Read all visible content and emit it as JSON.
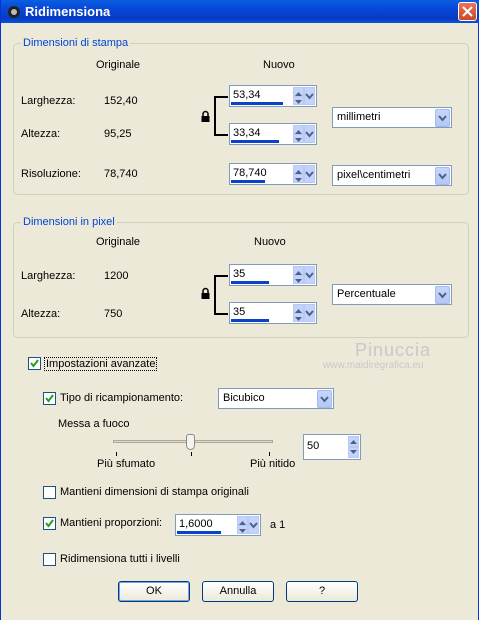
{
  "window": {
    "title": "Ridimensiona"
  },
  "print_size": {
    "title": "Dimensioni di stampa",
    "col_original": "Originale",
    "col_new": "Nuovo",
    "width_label": "Larghezza:",
    "width_original": "152,40",
    "width_new": "53,34",
    "height_label": "Altezza:",
    "height_original": "95,25",
    "height_new": "33,34",
    "units": "millimetri",
    "resolution_label": "Risoluzione:",
    "resolution_original": "78,740",
    "resolution_new": "78,740",
    "resolution_units": "pixel\\centimetri"
  },
  "pixel_size": {
    "title": "Dimensioni in pixel",
    "col_original": "Originale",
    "col_new": "Nuovo",
    "width_label": "Larghezza:",
    "width_original": "1200",
    "width_new": "35",
    "height_label": "Altezza:",
    "height_original": "750",
    "height_new": "35",
    "units": "Percentuale"
  },
  "advanced": {
    "label": "Impostazioni avanzate",
    "checked": true,
    "resample_label": "Tipo di ricampionamento:",
    "resample_checked": true,
    "resample_value": "Bicubico",
    "sharpness_label": "Messa a fuoco",
    "soft_label": "Più sfumato",
    "sharp_label": "Più nitido",
    "sharpness_value": "50",
    "keep_print_label": "Mantieni dimensioni di stampa originali",
    "keep_print_checked": false,
    "keep_ratio_label": "Mantieni proporzioni:",
    "keep_ratio_checked": true,
    "ratio_value": "1,6000",
    "ratio_suffix": "a 1",
    "resize_all_label": "Ridimensiona tutti i livelli",
    "resize_all_checked": false
  },
  "watermark": {
    "name": "Pinuccia",
    "url": "www.maidiregrafica.eu"
  },
  "buttons": {
    "ok": "OK",
    "cancel": "Annulla",
    "help": "?"
  },
  "colors": {
    "title_bar": "#0846d8",
    "group_title": "#0046d5",
    "face": "#ece9d8",
    "spin_bar": "#0a42c8"
  }
}
